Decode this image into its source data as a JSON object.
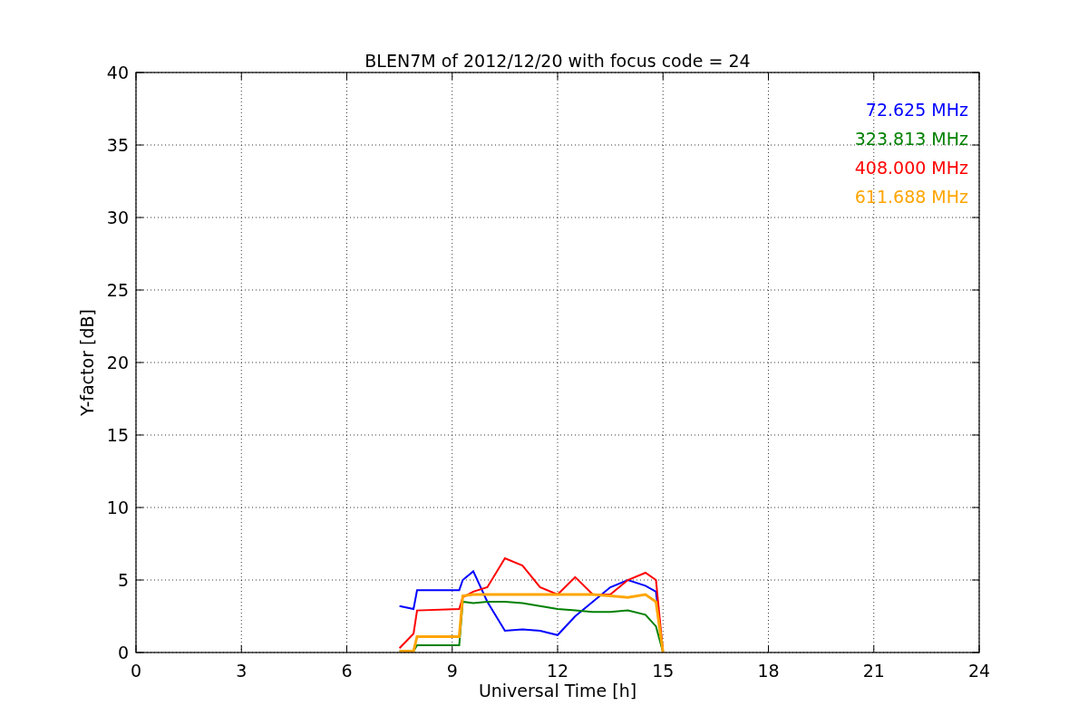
{
  "figure": {
    "chart_data": {
      "type": "line",
      "title": "BLEN7M of 2012/12/20 with focus code = 24",
      "xlabel": "Universal Time [h]",
      "ylabel": "Y-factor [dB]",
      "x": [
        7.5,
        7.9,
        8.0,
        9.2,
        9.3,
        9.6,
        10,
        10.5,
        11,
        11.5,
        12,
        12.5,
        13,
        13.5,
        14,
        14.5,
        14.8,
        15
      ],
      "series": [
        {
          "name": "72.625 MHz",
          "color": "#0000ff",
          "values": [
            3.2,
            3.0,
            4.3,
            4.3,
            5.0,
            5.6,
            3.5,
            1.5,
            1.6,
            1.5,
            1.2,
            2.5,
            3.5,
            4.5,
            5.0,
            4.6,
            4.2,
            0
          ]
        },
        {
          "name": "323.813 MHz",
          "color": "#008000",
          "values": [
            0.1,
            0.1,
            0.5,
            0.5,
            3.5,
            3.4,
            3.5,
            3.5,
            3.4,
            3.2,
            3.0,
            2.9,
            2.8,
            2.8,
            2.9,
            2.6,
            1.8,
            0
          ]
        },
        {
          "name": "408.000 MHz",
          "color": "#ff0000",
          "values": [
            0.3,
            1.3,
            2.9,
            3.0,
            3.8,
            4.2,
            4.5,
            6.5,
            6.0,
            4.5,
            4.0,
            5.2,
            4.0,
            4.0,
            5.0,
            5.5,
            5.0,
            0
          ]
        },
        {
          "name": "611.688 MHz",
          "color": "#ffa500",
          "values": [
            0.1,
            0.1,
            1.1,
            1.1,
            3.9,
            4.0,
            4.0,
            4.0,
            4.0,
            4.0,
            4.0,
            4.0,
            4.0,
            3.9,
            3.8,
            4.0,
            3.5,
            0
          ]
        }
      ],
      "grid": true,
      "xlim": [
        0,
        24
      ],
      "ylim": [
        0,
        40
      ],
      "xticks": [
        0,
        3,
        6,
        9,
        12,
        15,
        18,
        21,
        24
      ],
      "yticks": [
        0,
        5,
        10,
        15,
        20,
        25,
        30,
        35,
        40
      ]
    }
  }
}
